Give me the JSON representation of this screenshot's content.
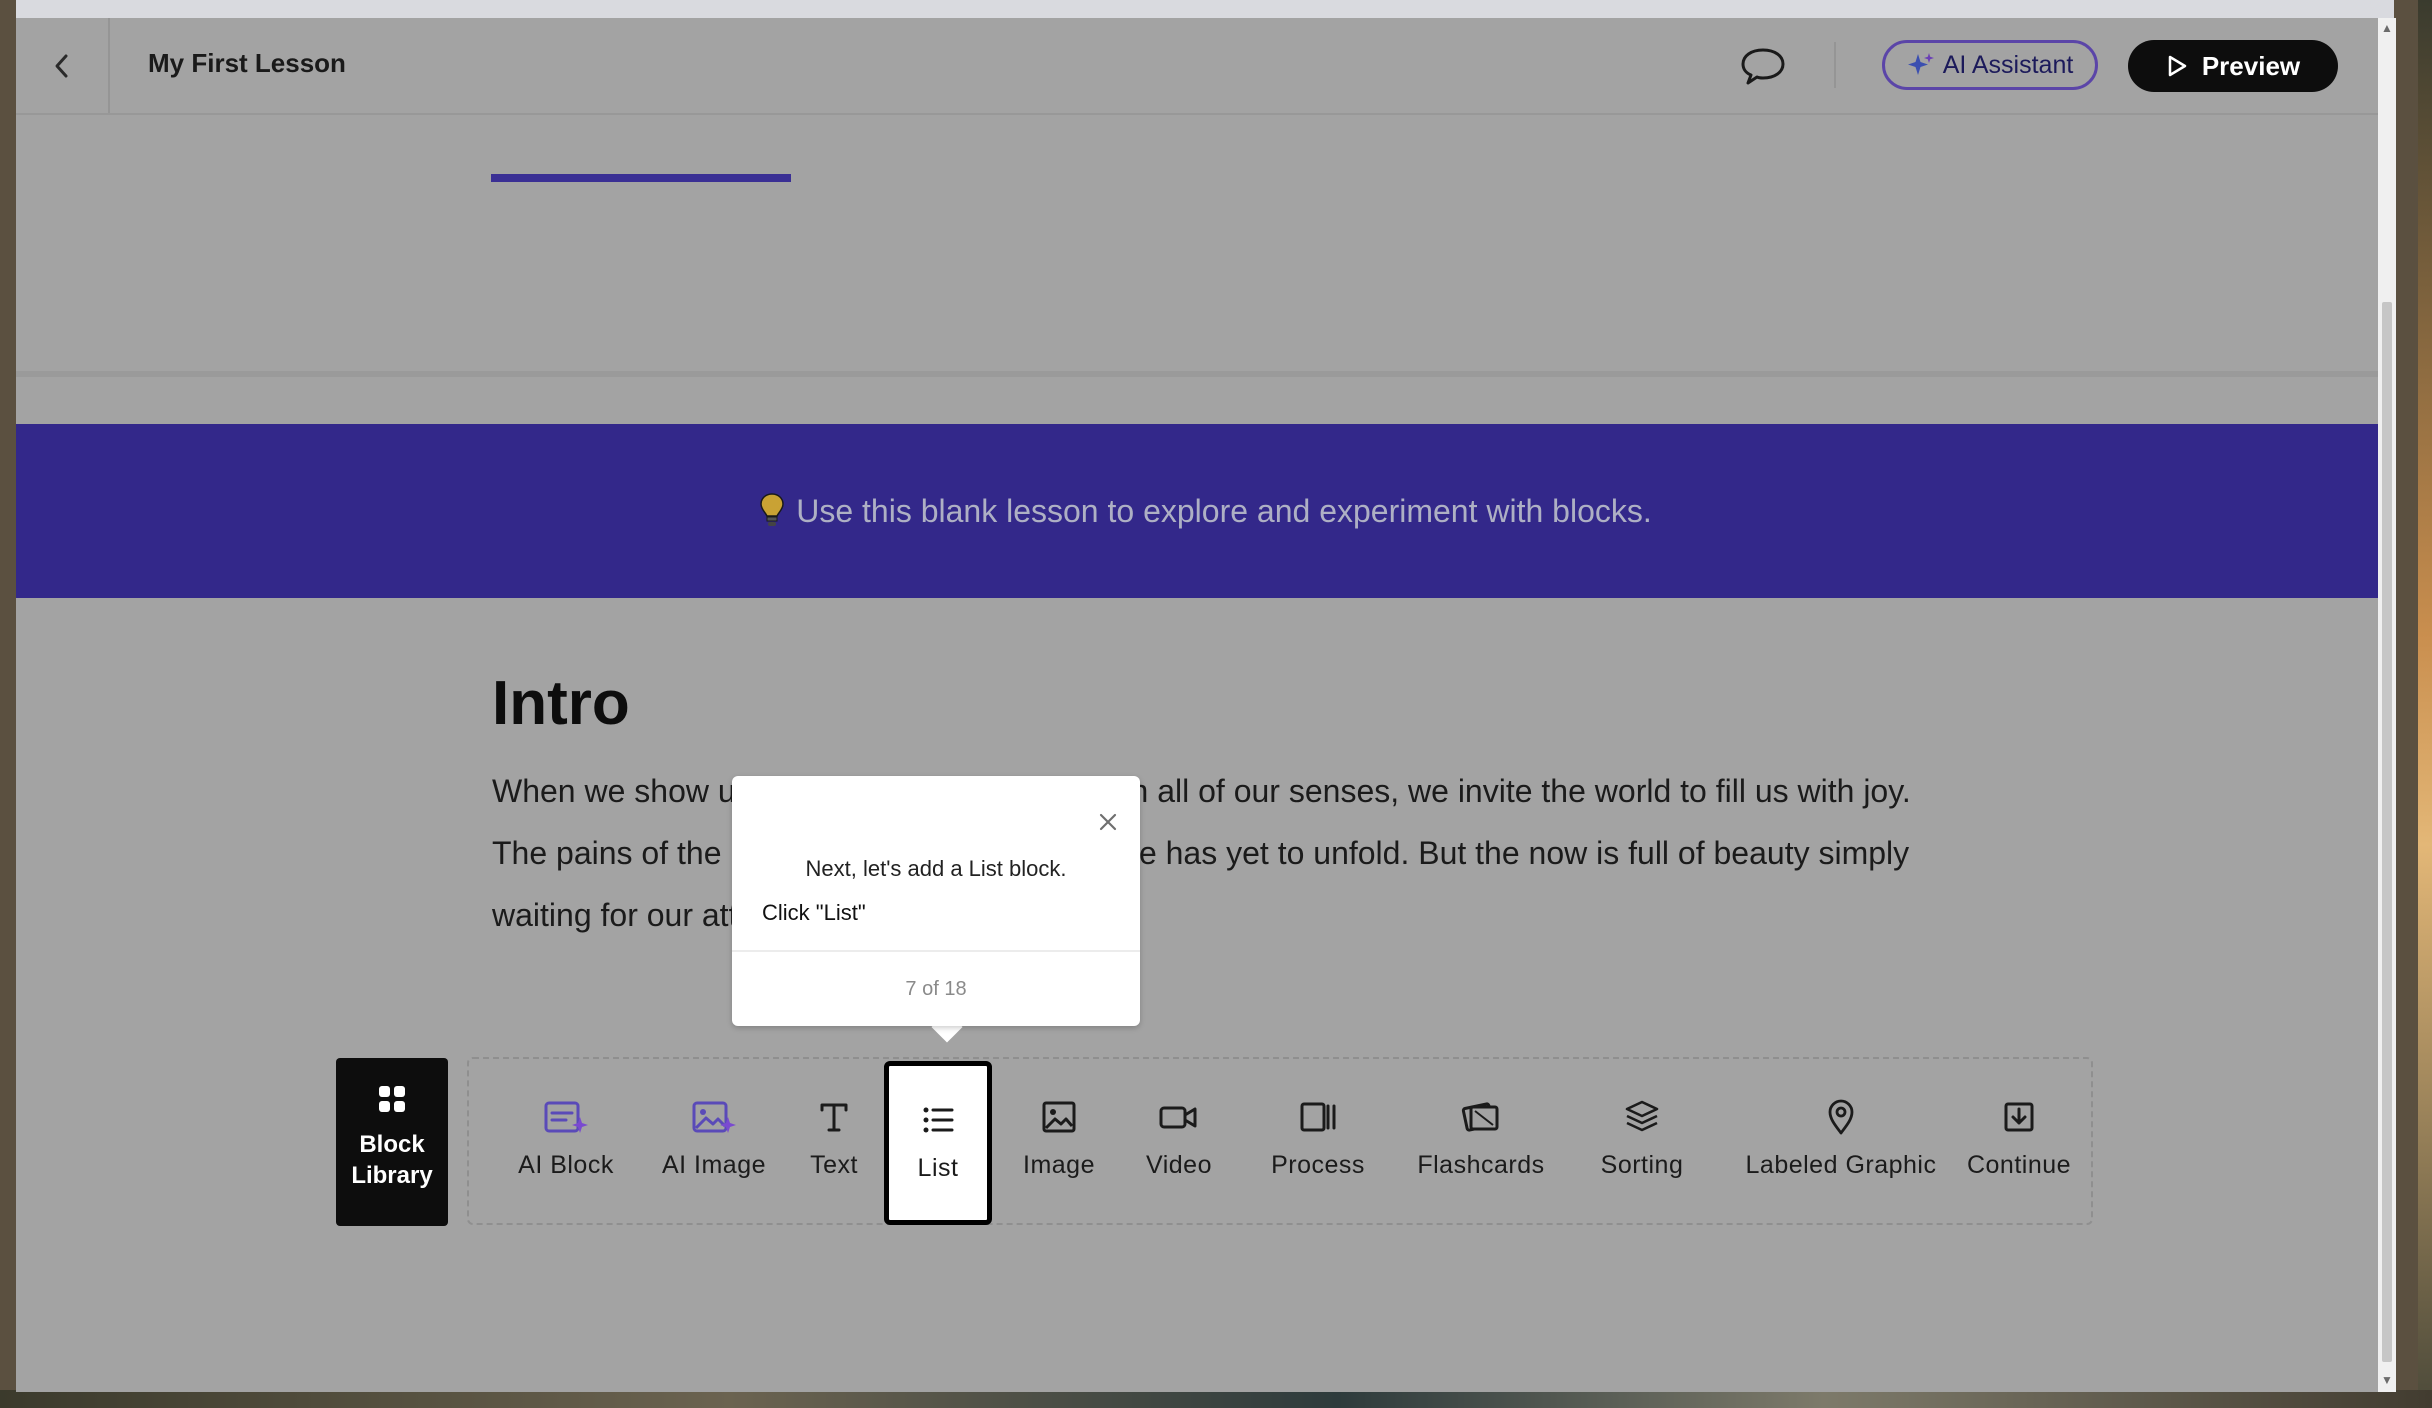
{
  "header": {
    "title": "My First Lesson",
    "ai_assistant_label": "AI Assistant",
    "preview_label": "Preview"
  },
  "banner": {
    "text": "Use this blank lesson to explore and experiment with blocks."
  },
  "content": {
    "heading": "Intro",
    "paragraph": "When we show up to the present moment with all of our senses, we invite the world to fill us with joy. The pains of the past are behind us. The future has yet to unfold. But the now is full of beauty simply waiting for our attention."
  },
  "tooltip": {
    "message": "Next, let's add a List block.",
    "instruction": "Click \"List\"",
    "step": "7 of 18"
  },
  "block_library": {
    "label_line1": "Block",
    "label_line2": "Library"
  },
  "toolbar": {
    "items": [
      {
        "label": "AI Block",
        "icon": "ai-block-icon"
      },
      {
        "label": "AI Image",
        "icon": "ai-image-icon"
      },
      {
        "label": "Text",
        "icon": "text-icon"
      },
      {
        "label": "List",
        "icon": "list-icon"
      },
      {
        "label": "Image",
        "icon": "image-icon"
      },
      {
        "label": "Video",
        "icon": "video-icon"
      },
      {
        "label": "Process",
        "icon": "process-icon"
      },
      {
        "label": "Flashcards",
        "icon": "flashcards-icon"
      },
      {
        "label": "Sorting",
        "icon": "sorting-icon"
      },
      {
        "label": "Labeled Graphic",
        "icon": "map-pin-icon"
      },
      {
        "label": "Continue",
        "icon": "continue-icon"
      }
    ],
    "active": "List"
  },
  "colors": {
    "banner": "#33288a",
    "progress": "#3a2f94",
    "ai_accent": "#5b45a8",
    "overlay_bg": "#a3a3a3"
  }
}
